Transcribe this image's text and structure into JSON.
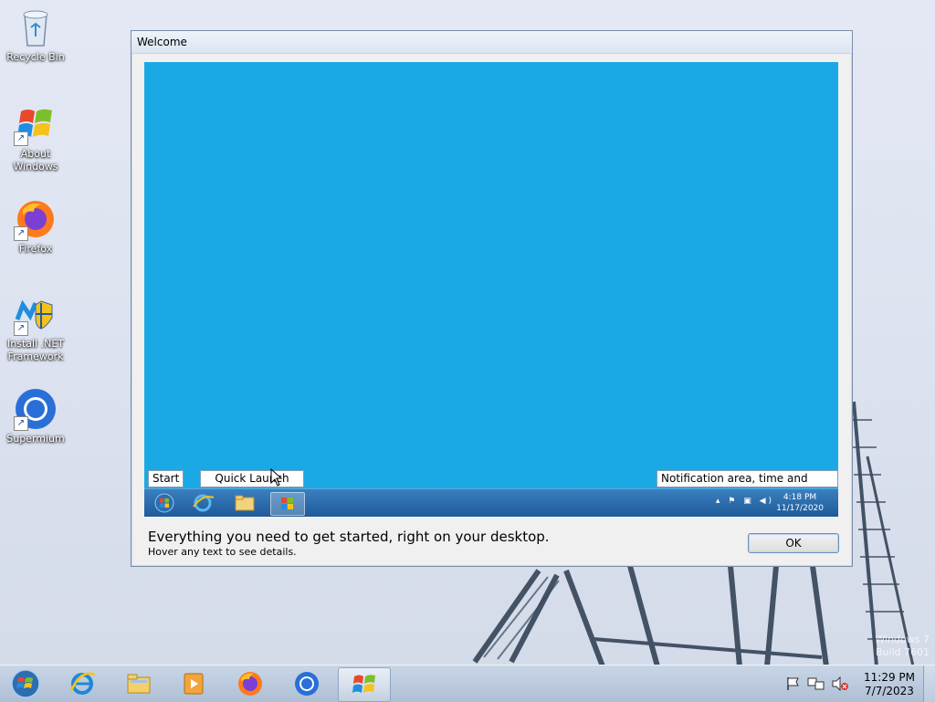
{
  "desktop": {
    "icons": [
      {
        "label": "Recycle Bin",
        "icon": "recycle-bin-icon"
      },
      {
        "label": "About Windows",
        "icon": "windows-logo-icon"
      },
      {
        "label": "Firefox",
        "icon": "firefox-icon"
      },
      {
        "label": "Install .NET Framework",
        "icon": "dotnet-installer-icon"
      },
      {
        "label": "Supermium",
        "icon": "supermium-icon"
      }
    ],
    "watermark_line1": "Windows 7",
    "watermark_line2": "Build 7601"
  },
  "welcome_window": {
    "title": "Welcome",
    "preview": {
      "start_label": "Start",
      "quick_launch_label": "Quick Launch",
      "notification_label": "Notification area, time and date",
      "mini_clock_time": "4:18 PM",
      "mini_clock_date": "11/17/2020"
    },
    "footer_main": "Everything you need to get started, right on your desktop.",
    "footer_sub": "Hover any text to see details.",
    "ok_label": "OK"
  },
  "taskbar": {
    "items": [
      "start-orb",
      "internet-explorer",
      "windows-explorer",
      "media-player",
      "firefox",
      "supermium",
      "welcome-center"
    ],
    "clock_time": "11:29 PM",
    "clock_date": "7/7/2023"
  },
  "colors": {
    "preview_bg": "#1ba9e6",
    "taskbar_bg": "#c9d6e6"
  }
}
